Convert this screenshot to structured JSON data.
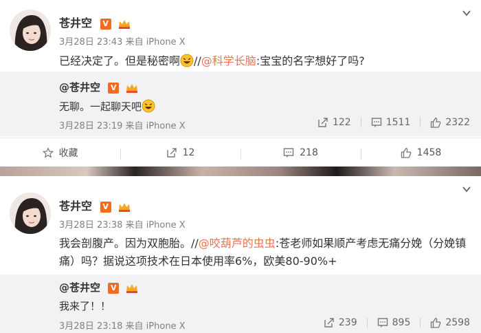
{
  "post1": {
    "author": "苍井空",
    "time": "3月28日 23:43",
    "source": "来自 iPhone X",
    "content_main": "已经决定了。但是秘密啊",
    "content_sep": "//",
    "mention": "@科学长脑",
    "content_rest": ":宝宝的名字想好了吗?",
    "repost": {
      "author": "@苍井空",
      "text": "无聊。一起聊天吧",
      "time": "3月28日 23:19 来自 iPhone X",
      "forwards": "122",
      "comments": "1511",
      "likes": "2322"
    },
    "actions": {
      "favorite": "收藏",
      "forward": "12",
      "comment": "218",
      "like": "1458"
    }
  },
  "post2": {
    "author": "苍井空",
    "time": "3月28日 23:38",
    "source": "来自 iPhone X",
    "content_main": "我会剖腹产。因为双胞胎。",
    "content_sep": "//",
    "mention": "@咬葫芦的虫虫",
    "content_rest": ":苍老师如果顺产考虑无痛分娩（分娩镇痛）吗？据说这项技术在日本使用率6%，欧美80-90%+",
    "repost": {
      "author": "@苍井空",
      "text": "我来了！！",
      "time": "3月28日 23:18 来自 iPhone X",
      "forwards": "239",
      "comments": "895",
      "likes": "2598"
    }
  },
  "badges": {
    "verified": "V"
  },
  "colors": {
    "mention": "#eb7350",
    "repost_bg": "#f2f2f5",
    "verified": "#f26c1c"
  },
  "icons": [
    "chevron-down-icon",
    "star-icon",
    "forward-icon",
    "comment-icon",
    "like-icon",
    "laugh-emoji-icon",
    "vip-crown-icon"
  ]
}
